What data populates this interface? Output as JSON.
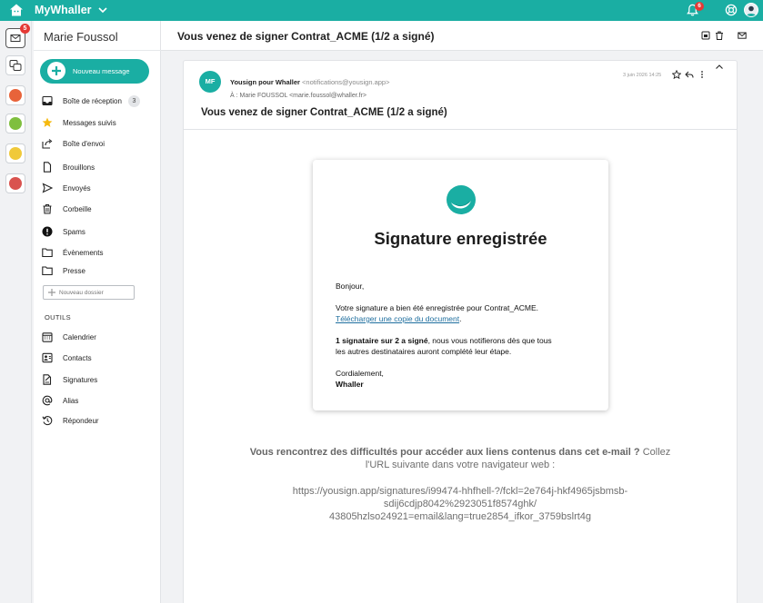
{
  "topbar": {
    "app_name": "MyWhaller",
    "notifications_count": "6",
    "brand_color": "#1aaea3"
  },
  "rail": {
    "mail_badge": "5",
    "space_colors": [
      "#e8633a",
      "#7fbf3f",
      "#f0c93a",
      "#d9534f"
    ]
  },
  "sidebar": {
    "account_name": "Marie Foussol",
    "new_message_label": "Nouveau message",
    "folders": [
      {
        "label": "Boîte de réception",
        "icon": "inbox-icon",
        "count": "3"
      },
      {
        "label": "Messages suivis",
        "icon": "star-icon"
      },
      {
        "label": "Boîte d'envoi",
        "icon": "outbox-icon"
      },
      {
        "label": "Brouillons",
        "icon": "draft-icon"
      },
      {
        "label": "Envoyés",
        "icon": "sent-icon"
      },
      {
        "label": "Corbeille",
        "icon": "trash-icon"
      },
      {
        "label": "Spams",
        "icon": "spam-icon"
      },
      {
        "label": "Évènements",
        "icon": "folder-icon"
      },
      {
        "label": "Presse",
        "icon": "folder-icon"
      }
    ],
    "new_folder_placeholder": "Nouveau dossier",
    "tools_title": "OUTILS",
    "tools": [
      {
        "label": "Calendrier",
        "icon": "calendar-icon"
      },
      {
        "label": "Contacts",
        "icon": "contacts-icon"
      },
      {
        "label": "Signatures",
        "icon": "signature-icon"
      },
      {
        "label": "Alias",
        "icon": "at-icon"
      },
      {
        "label": "Répondeur",
        "icon": "autoreply-icon"
      }
    ]
  },
  "message": {
    "subject": "Vous venez de signer Contrat_ACME (1/2 a signé)",
    "sender_initials": "MF",
    "sender_name": "Yousign pour Whaller",
    "sender_email": "<notifications@yousign.app>",
    "to_line": "À : Marie FOUSSOL <marie.foussol@whaller.fr>",
    "date": "3 juin 2026 14:25",
    "title": "Vous venez de signer Contrat_ACME (1/2 a signé)"
  },
  "email_body": {
    "heading": "Signature enregistrée",
    "greeting": "Bonjour,",
    "line1": "Votre signature a bien été enregistrée pour Contrat_ACME.",
    "download_link": "Télécharger une copie du document",
    "download_after": ".",
    "status_bold": "1 signataire sur 2 a signé",
    "status_rest": ", nous vous notifierons dès que tous",
    "status_line2": "les autres destinataires auront complété leur étape.",
    "closing": "Cordialement,",
    "signature": "Whaller"
  },
  "footer": {
    "bold": "Vous rencontrez des difficultés pour accéder aux liens contenus dans cet e-mail ?",
    "rest": " Collez",
    "line2": "l'URL suivante dans votre navigateur web :",
    "url_line1": "https://yousign.app/signatures/i99474-hhfhell-?/fckl=2e764j-hkf4965jsbmsb-",
    "url_line2": "sdij6cdjp8042%2923051f8574ghk/",
    "url_line3": "43805hzlso24921=email&lang=true2854_ifkor_3759bslrt4g"
  }
}
